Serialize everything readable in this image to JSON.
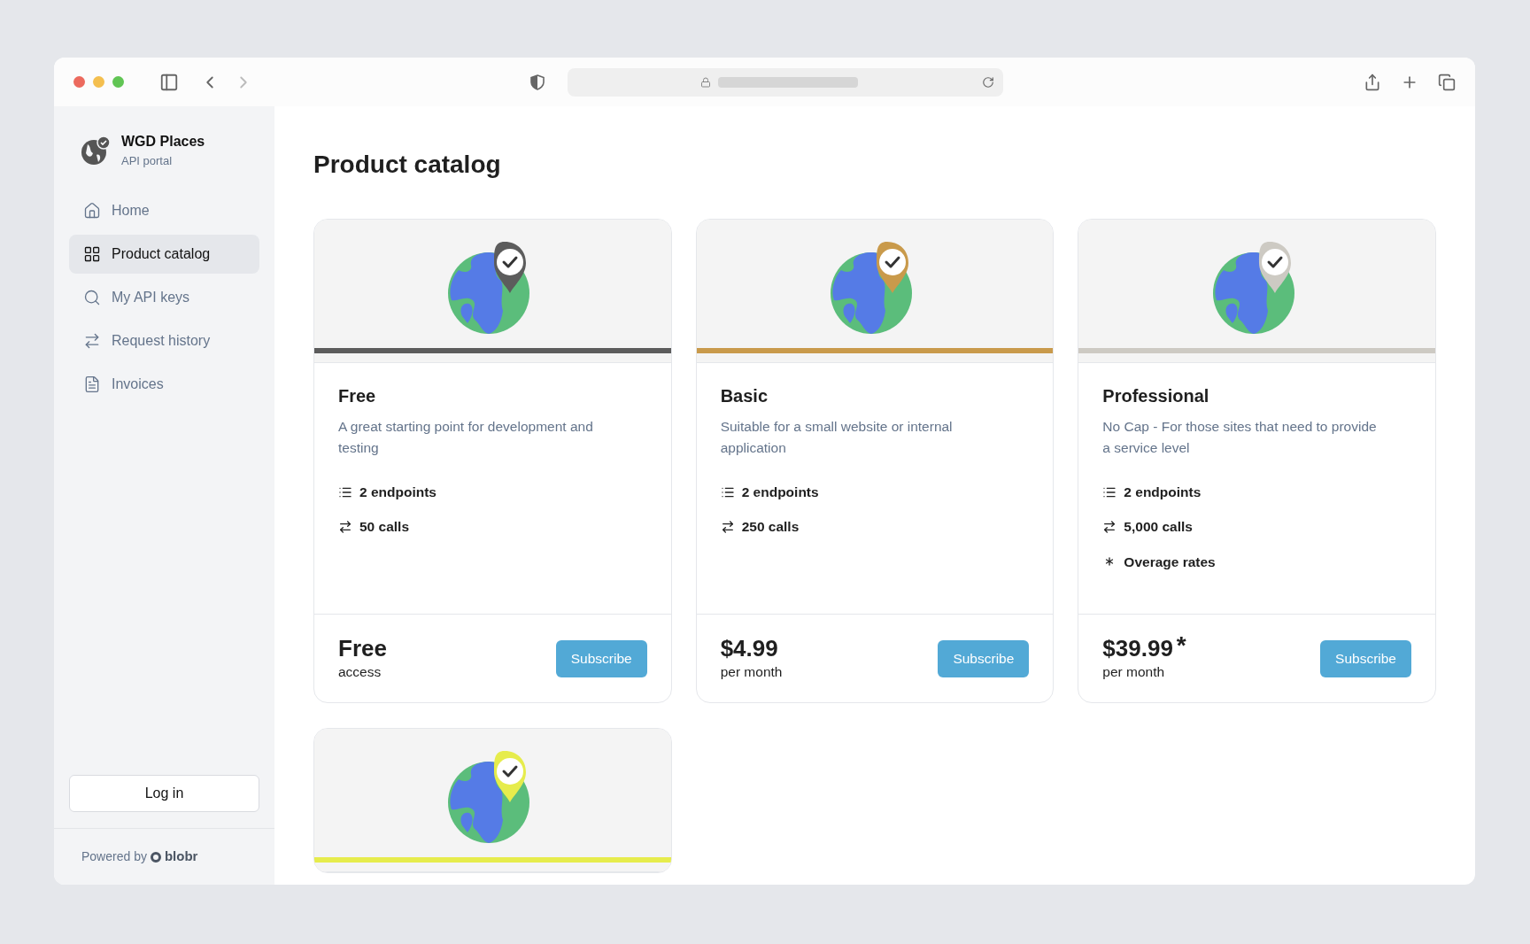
{
  "sidebar": {
    "brand": {
      "name": "WGD Places",
      "subtitle": "API portal"
    },
    "items": [
      {
        "label": "Home",
        "kind": "home",
        "selected": false
      },
      {
        "label": "Product catalog",
        "kind": "catalog",
        "selected": true
      },
      {
        "label": "My API keys",
        "kind": "keys",
        "selected": false
      },
      {
        "label": "Request history",
        "kind": "history",
        "selected": false
      },
      {
        "label": "Invoices",
        "kind": "invoices",
        "selected": false
      }
    ],
    "login_button": "Log in",
    "powered_by": "Powered by",
    "powered_brand": "blobr"
  },
  "page": {
    "title": "Product catalog"
  },
  "cards": [
    {
      "name": "Free",
      "color": "#5c5c5c",
      "description": "A great starting point for development and testing",
      "features": [
        {
          "kind": "endpoints",
          "text": "2 endpoints"
        },
        {
          "kind": "calls",
          "text": "50 calls"
        }
      ],
      "price": "Free",
      "period": "access",
      "button": "Subscribe"
    },
    {
      "name": "Basic",
      "color": "#c99a4b",
      "description": "Suitable for a small website or internal application",
      "features": [
        {
          "kind": "endpoints",
          "text": "2 endpoints"
        },
        {
          "kind": "calls",
          "text": "250 calls"
        }
      ],
      "price": "$4.99",
      "period": "per month",
      "button": "Subscribe"
    },
    {
      "name": "Professional",
      "color": "#cdcac3",
      "description": "No Cap - For those sites that need to provide a service level",
      "features": [
        {
          "kind": "endpoints",
          "text": "2 endpoints"
        },
        {
          "kind": "calls",
          "text": "5,000 calls"
        },
        {
          "kind": "overage",
          "text": "Overage rates"
        }
      ],
      "price": "$39.99",
      "price_mark": "*",
      "period": "per month",
      "button": "Subscribe"
    },
    {
      "color": "#e6ec4c"
    }
  ]
}
